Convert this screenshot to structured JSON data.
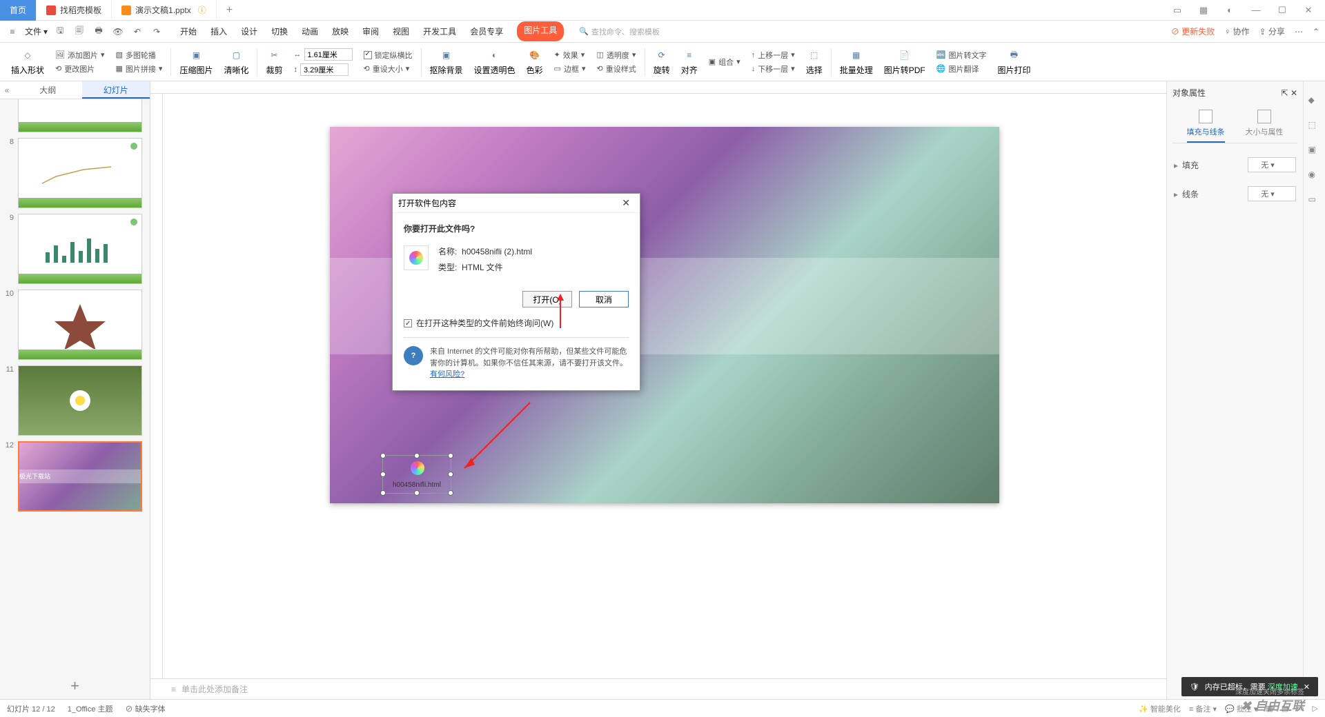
{
  "titlebar": {
    "home": "首页",
    "tab1": "找稻壳模板",
    "tab2": "演示文稿1.pptx",
    "add": "+"
  },
  "winbuttons": {
    "grid1": "▭",
    "grid2": "▦",
    "avatar": "◐",
    "min": "—",
    "max": "☐",
    "close": "✕"
  },
  "menubar": {
    "file": "文件",
    "tabs": [
      "开始",
      "插入",
      "设计",
      "切换",
      "动画",
      "放映",
      "审阅",
      "视图",
      "开发工具",
      "会员专享"
    ],
    "activeTab": "图片工具",
    "searchPlaceholder": "查找命令、搜索模板",
    "right": {
      "fail": "⊘ 更新失败",
      "collab": "♀ 协作",
      "share": "⇪ 分享"
    }
  },
  "ribbon": {
    "insertShape": "插入形状",
    "addImage": "添加图片",
    "replaceImage": "更改图片",
    "multiContour": "多图轮播",
    "imageStitch": "图片拼接",
    "compress": "压缩图片",
    "clarify": "清晰化",
    "crop": "裁剪",
    "width": "1.61厘米",
    "height": "3.29厘米",
    "lockRatio": "锁定纵横比",
    "resetSize": "重设大小",
    "removeBg": "抠除背景",
    "setTransColor": "设置透明色",
    "colorAdj": "色彩",
    "effects": "效果",
    "transparency": "透明度",
    "border": "边框",
    "resetStyle": "重设样式",
    "rotate": "旋转",
    "align": "对齐",
    "combine": "组合",
    "moveUp": "上移一层",
    "moveDown": "下移一层",
    "select": "选择",
    "batch": "批量处理",
    "toPdf": "图片转PDF",
    "pic2text": "图片转文字",
    "translate": "图片翻译",
    "print": "图片打印"
  },
  "leftpanel": {
    "tab_outline": "大纲",
    "tab_slides": "幻灯片",
    "slides": [
      {
        "num": "8"
      },
      {
        "num": "9"
      },
      {
        "num": "10"
      },
      {
        "num": "11"
      },
      {
        "num": "12"
      }
    ],
    "add": "+"
  },
  "canvas": {
    "objectLabel": "h00458nifli.html",
    "notes_icon": "≡",
    "notes": "单击此处添加备注"
  },
  "dialog": {
    "title": "打开软件包内容",
    "question": "你要打开此文件吗?",
    "nameLabel": "名称:",
    "nameValue": "h00458nifli (2).html",
    "typeLabel": "类型:",
    "typeValue": "HTML 文件",
    "open": "打开(O)",
    "cancel": "取消",
    "alwaysAsk": "在打开这种类型的文件前始终询问(W)",
    "warnText": "来自 Internet 的文件可能对你有所帮助，但某些文件可能危害你的计算机。如果你不信任其来源，请不要打开该文件。",
    "riskLink": "有何风险?"
  },
  "rightpanel": {
    "title": "对象属性",
    "tab1": "填充与线条",
    "tab2": "大小与属性",
    "fill": "填充",
    "line": "线条",
    "none": "无"
  },
  "statusbar": {
    "slideInfo": "幻灯片 12 / 12",
    "theme": "1_Office 主题",
    "missingFont": "缺失字体",
    "beautify": "智能美化",
    "notes": "备注",
    "batch": "批注"
  },
  "toast": {
    "text1": "内存已超标，需要",
    "text2": "深度加速"
  },
  "watermark": "自由互联",
  "watermark_sub": "深度加速关闭多余标签"
}
